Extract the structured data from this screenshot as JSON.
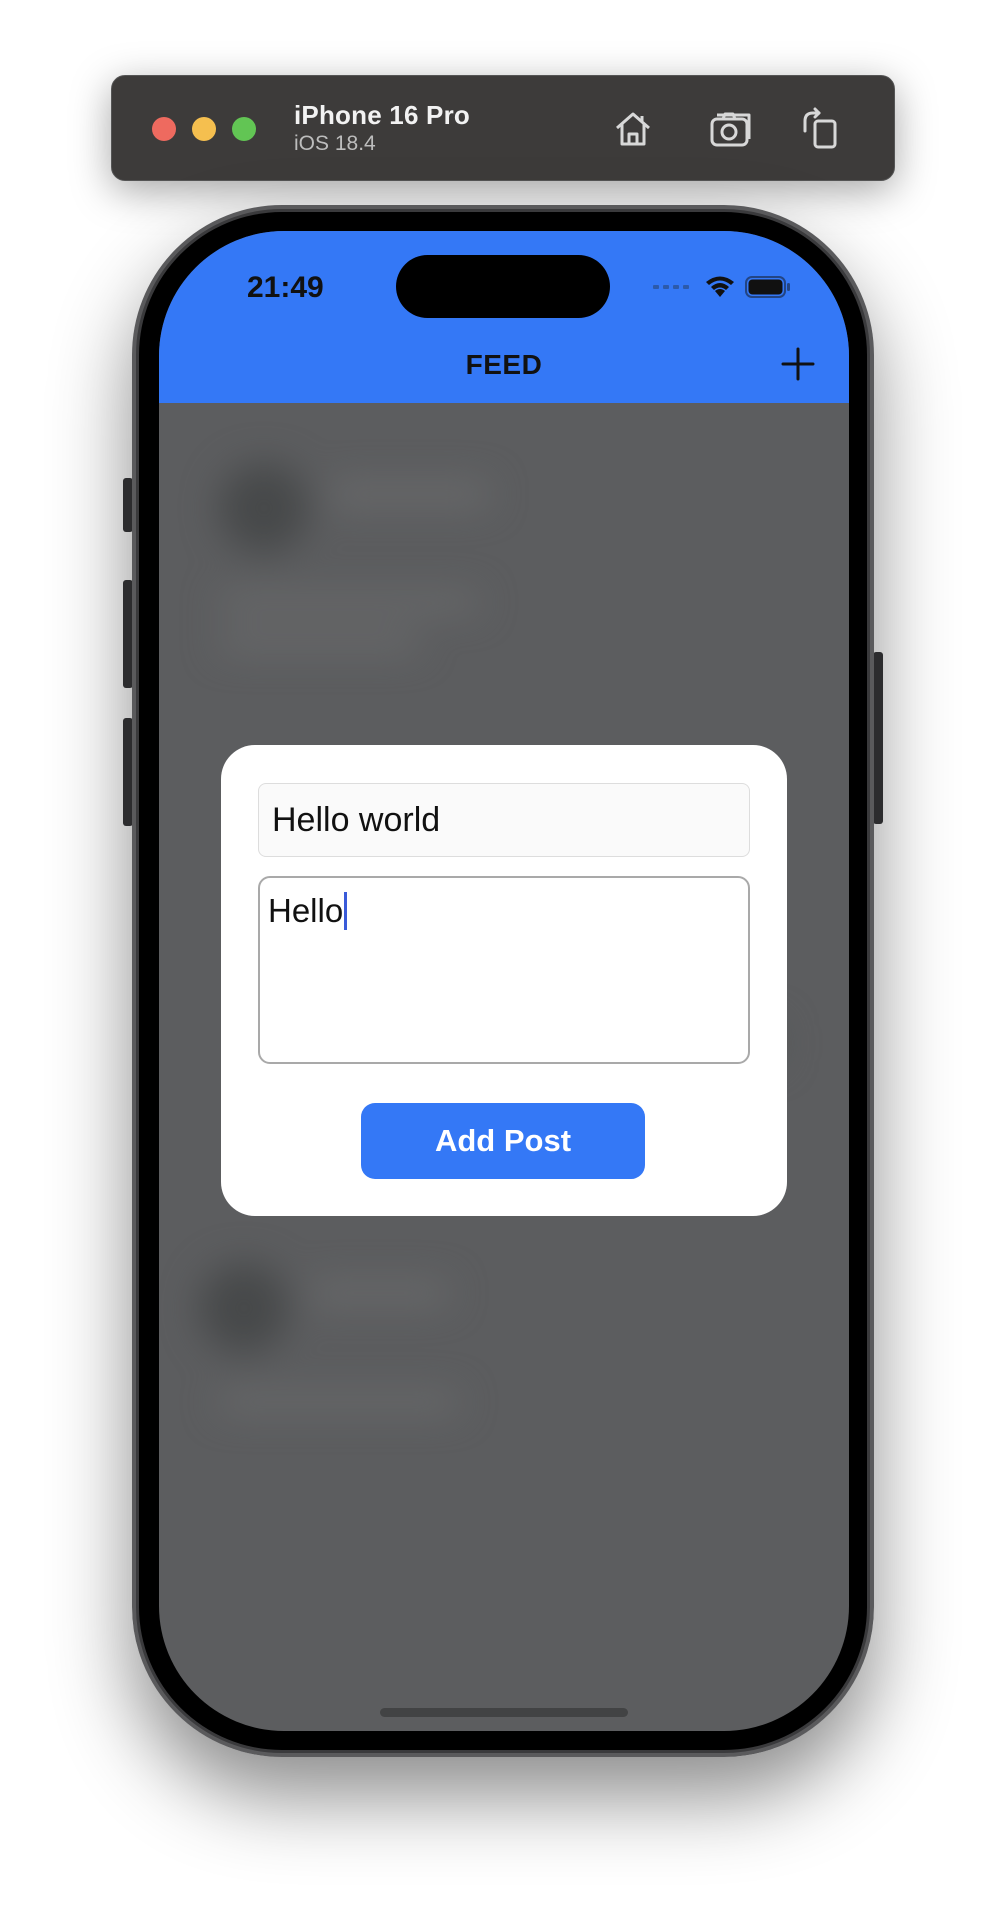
{
  "simulator": {
    "device_name": "iPhone 16 Pro",
    "os_version": "iOS 18.4",
    "buttons": [
      "home-icon",
      "screenshot-icon",
      "rotate-icon"
    ]
  },
  "status_bar": {
    "time": "21:49"
  },
  "header": {
    "title": "FEED",
    "add_icon": "plus-icon",
    "color": "#3478f6"
  },
  "modal": {
    "title_value": "Hello world",
    "body_value": "Hello",
    "submit_label": "Add Post"
  }
}
